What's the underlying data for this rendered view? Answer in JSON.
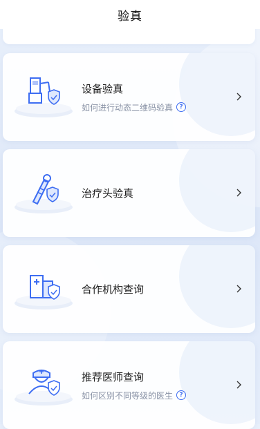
{
  "header": {
    "title": "验真"
  },
  "cards": [
    {
      "title": "设备验真",
      "subtitle": "如何进行动态二维码验真",
      "has_help": true,
      "icon": "device-verify-icon"
    },
    {
      "title": "治疗头验真",
      "subtitle": "",
      "has_help": false,
      "icon": "treatment-head-icon"
    },
    {
      "title": "合作机构查询",
      "subtitle": "",
      "has_help": false,
      "icon": "institution-icon"
    },
    {
      "title": "推荐医师查询",
      "subtitle": "如何区别不同等级的医生",
      "has_help": true,
      "icon": "doctor-icon"
    }
  ],
  "colors": {
    "accent": "#3d6df2",
    "background": "#e4ecfa",
    "card": "#ffffff"
  }
}
